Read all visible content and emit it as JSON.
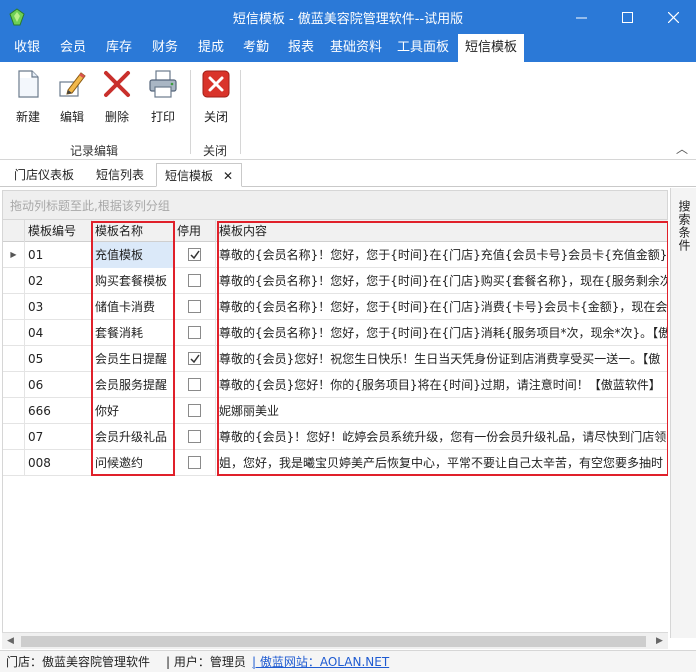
{
  "window": {
    "title": "短信模板 - 傲蓝美容院管理软件--试用版",
    "controls": [
      "minimize-icon",
      "maximize-icon",
      "close-icon"
    ]
  },
  "menu": {
    "tabs": [
      "收银",
      "会员",
      "库存",
      "财务",
      "提成",
      "考勤",
      "报表",
      "基础资料",
      "工具面板",
      "短信模板"
    ],
    "active": "短信模板"
  },
  "ribbon": {
    "buttons": [
      {
        "label": "新建",
        "icon": "new-document-icon"
      },
      {
        "label": "编辑",
        "icon": "edit-pencil-icon"
      },
      {
        "label": "删除",
        "icon": "delete-x-icon"
      },
      {
        "label": "打印",
        "icon": "printer-icon"
      },
      {
        "label": "关闭",
        "icon": "close-red-icon"
      }
    ],
    "groups": [
      "记录编辑",
      "关闭"
    ],
    "collapse_glyph": "︿"
  },
  "doc_tabs": [
    {
      "label": "门店仪表板"
    },
    {
      "label": "短信列表"
    },
    {
      "label": "短信模板",
      "closable": true
    }
  ],
  "group_panel": {
    "placeholder": "拖动列标题至此,根据该列分组"
  },
  "side_panel": {
    "label": "搜索条件"
  },
  "grid": {
    "columns": [
      "模板编号",
      "模板名称",
      "停用",
      "模板内容"
    ],
    "rows": [
      {
        "code": "01",
        "name": "充值模板",
        "disabled": true,
        "content": "尊敬的{会员名称}！您好，您于{时间}在{门店}充值{会员卡号}会员卡{充值金额}，现"
      },
      {
        "code": "02",
        "name": "购买套餐模板",
        "disabled": false,
        "content": "尊敬的{会员名称}！您好，您于{时间}在{门店}购买{套餐名称}，现在{服务剩余次数"
      },
      {
        "code": "03",
        "name": "储值卡消费",
        "disabled": false,
        "content": "尊敬的{会员名称}！您好，您于{时间}在{门店}消费{卡号}会员卡{金额}，现在会员一"
      },
      {
        "code": "04",
        "name": "套餐消耗",
        "disabled": false,
        "content": "尊敬的{会员名称}！您好，您于{时间}在{门店}消耗{服务项目*次，现余*次}。【傲"
      },
      {
        "code": "05",
        "name": "会员生日提醒",
        "disabled": true,
        "content": "尊敬的{会员}您好！祝您生日快乐！生日当天凭身份证到店消费享受买一送一。【傲"
      },
      {
        "code": "06",
        "name": "会员服务提醒",
        "disabled": false,
        "content": "尊敬的{会员}您好！你的{服务项目}将在{时间}过期，请注意时间！【傲蓝软件】"
      },
      {
        "code": "666",
        "name": "你好",
        "disabled": false,
        "content": "妮娜丽美业"
      },
      {
        "code": "07",
        "name": "会员升级礼品",
        "disabled": false,
        "content": "尊敬的{会员}！您好！屹婷会员系统升级，您有一份会员升级礼品，请尽快到门店领"
      },
      {
        "code": "008",
        "name": "问候邀约",
        "disabled": false,
        "content": "姐，您好，我是曦宝贝婷美产后恢复中心，平常不要让自己太辛苦，有空您要多抽时"
      }
    ],
    "row_indicator": "▶"
  },
  "statusbar": {
    "store": "门店：傲蓝美容院管理软件",
    "user": "| 用户：管理员",
    "website": "| 傲蓝网站：AOLAN.NET"
  },
  "colors": {
    "titlebar": "#2b79d7",
    "highlight_box": "#e0202a",
    "link": "#1f5bd1"
  }
}
